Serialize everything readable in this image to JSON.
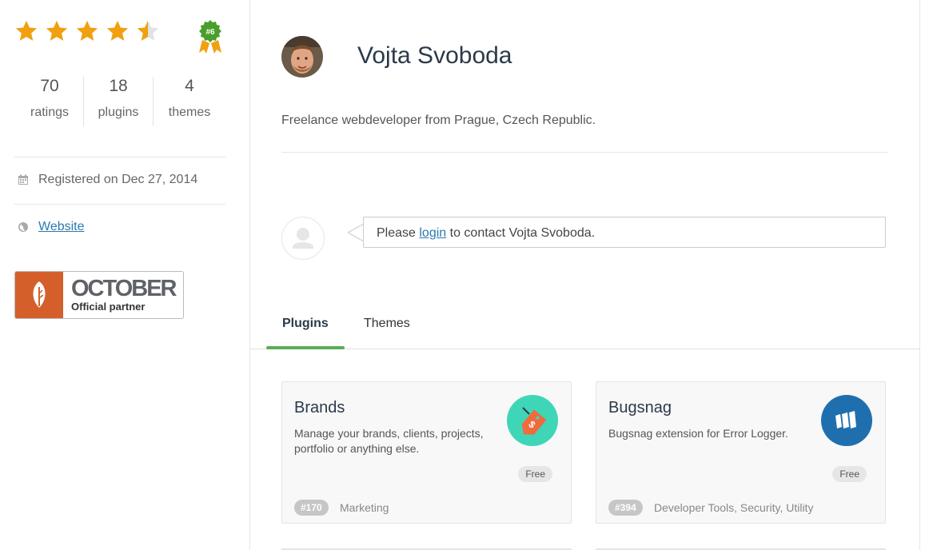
{
  "profile": {
    "name": "Vojta Svoboda",
    "bio": "Freelance webdeveloper from Prague, Czech Republic.",
    "rating_stars": 4.5,
    "rank_badge": "#6"
  },
  "stats": [
    {
      "value": "70",
      "label": "ratings"
    },
    {
      "value": "18",
      "label": "plugins"
    },
    {
      "value": "4",
      "label": "themes"
    }
  ],
  "meta": {
    "registered": "Registered on Dec 27, 2014",
    "website_label": "Website"
  },
  "partner": {
    "brand": "OCTOBER",
    "subtitle": "Official partner"
  },
  "contact": {
    "prefix": "Please ",
    "login_link": "login",
    "suffix": " to contact Vojta Svoboda."
  },
  "tabs": [
    {
      "label": "Plugins",
      "active": true
    },
    {
      "label": "Themes",
      "active": false
    }
  ],
  "plugins": [
    {
      "title": "Brands",
      "description": "Manage your brands, clients, projects, portfolio or anything else.",
      "price": "Free",
      "rank": "#170",
      "categories": "Marketing",
      "icon": "price-tag-icon",
      "icon_bg": "#3fd6b8"
    },
    {
      "title": "Bugsnag",
      "description": "Bugsnag extension for Error Logger.",
      "price": "Free",
      "rank": "#394",
      "categories": "Developer Tools, Security, Utility",
      "icon": "bugsnag-logo-icon",
      "icon_bg": "#1f6faf"
    }
  ],
  "colors": {
    "star": "#f0a010",
    "star_empty": "#e2e2e2",
    "link": "#2a7ab0",
    "tab_active_underline": "#5aad5a",
    "partner_orange": "#d45f2a",
    "badge_green": "#4a9e2a"
  }
}
